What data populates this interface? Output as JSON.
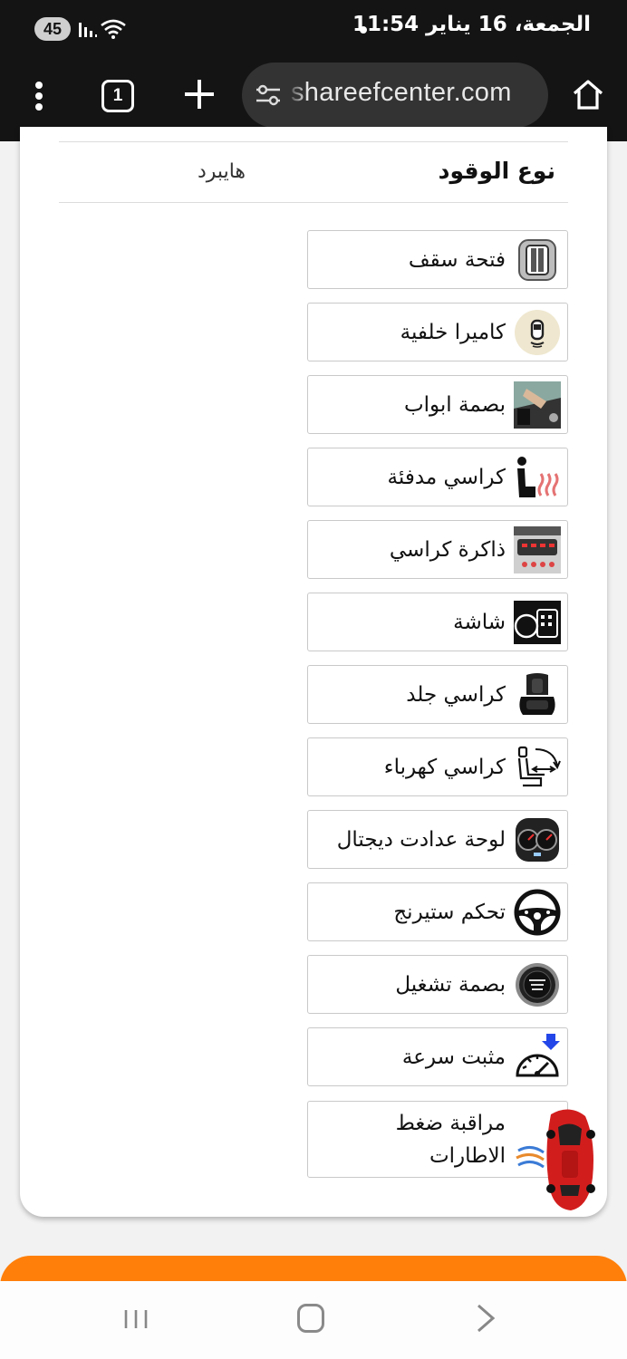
{
  "status_bar": {
    "battery": "45",
    "time": "الجمعة، 16 يناير 11:54"
  },
  "browser": {
    "tab_count": "1",
    "url": "shareefcenter.com"
  },
  "spec": {
    "label": "نوع الوقود",
    "value": "هايبرد"
  },
  "features": [
    {
      "label": "فتحة سقف",
      "icon": "sunroof-icon"
    },
    {
      "label": "كاميرا خلفية",
      "icon": "rear-camera-icon"
    },
    {
      "label": "بصمة ابواب",
      "icon": "keyless-entry-icon"
    },
    {
      "label": "كراسي مدفئة",
      "icon": "heated-seat-icon"
    },
    {
      "label": "ذاكرة كراسي",
      "icon": "seat-memory-icon"
    },
    {
      "label": "شاشة",
      "icon": "screen-icon"
    },
    {
      "label": "كراسي جلد",
      "icon": "leather-seat-icon"
    },
    {
      "label": "كراسي كهرباء",
      "icon": "power-seat-icon"
    },
    {
      "label": "لوحة عدادت ديجتال",
      "icon": "digital-cluster-icon"
    },
    {
      "label": "تحكم ستيرنج",
      "icon": "steering-control-icon"
    },
    {
      "label": "بصمة تشغيل",
      "icon": "push-start-icon"
    },
    {
      "label": "مثبت سرعة",
      "icon": "cruise-control-icon"
    },
    {
      "label": "مراقبة ضغط الاطارات",
      "icon": "tire-pressure-icon"
    }
  ],
  "colors": {
    "accent": "#ff7f0a",
    "bar": "#141414"
  }
}
